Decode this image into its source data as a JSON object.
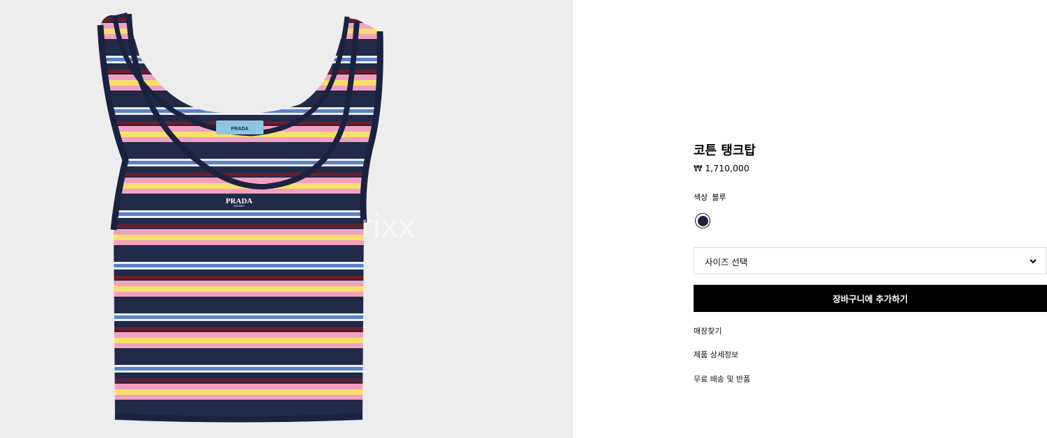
{
  "watermark": "rixx",
  "brand_label": {
    "name": "PRADA",
    "city": "MILANO"
  },
  "product": {
    "title": "코튼 탱크탑",
    "price": "₩ 1,710,000",
    "color_label": "색상",
    "color_value": "블루",
    "swatch_color": "#1d2440"
  },
  "size_select": {
    "placeholder": "사이즈 선택"
  },
  "cart_button": {
    "label": "장바구니에 추가하기"
  },
  "links": [
    "매장찾기",
    "제품 상세정보",
    "무료 배송 및 반품"
  ],
  "stripe_colors": {
    "navy": "#212a48",
    "pink": "#f2a0c2",
    "yellow": "#f4e06a",
    "blue": "#5a82c9",
    "maroon": "#6b1d2a",
    "white": "#eef0f5"
  }
}
